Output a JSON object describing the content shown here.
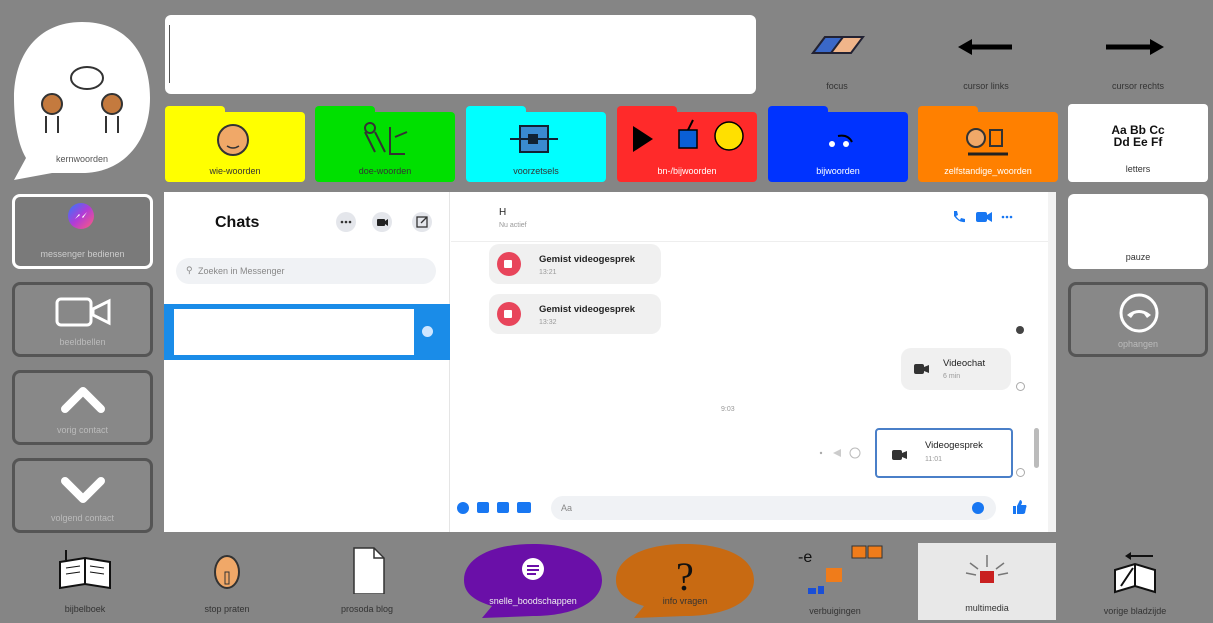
{
  "message_field": {
    "value": ""
  },
  "top_controls": [
    {
      "name": "eraser-icon",
      "label": "focus"
    },
    {
      "name": "arrow-left-icon",
      "label": "cursor links"
    },
    {
      "name": "arrow-right-icon",
      "label": "cursor rechts"
    }
  ],
  "kern": {
    "label": "kernwoorden"
  },
  "folders": [
    {
      "label": "wie-woorden",
      "color": "#ffff00"
    },
    {
      "label": "doe-woorden",
      "color": "#00e000"
    },
    {
      "label": "voorzetsels",
      "color": "#00ffff"
    },
    {
      "label": "bn-/bijwoorden",
      "color": "#ff2a2a"
    },
    {
      "label": "bijwoorden",
      "color": "#0033ff"
    },
    {
      "label": "zelfstandige_woorden",
      "color": "#ff8000"
    }
  ],
  "letters": {
    "sample": "Aa Bb Cc\nDd Ee Ff",
    "label": "letters"
  },
  "left_buttons": [
    {
      "label": "messenger bedienen"
    },
    {
      "label": "beeldbellen"
    },
    {
      "label": "vorig contact"
    },
    {
      "label": "volgend contact"
    }
  ],
  "right_buttons": [
    {
      "label": "pauze"
    },
    {
      "label": "ophangen"
    }
  ],
  "messenger": {
    "chats_title": "Chats",
    "search_placeholder": "Zoeken in Messenger",
    "contact_name": "H",
    "contact_status": "Nu actief",
    "messages": [
      {
        "title": "Gemist videogesprek",
        "time": "13:21"
      },
      {
        "title": "Gemist videogesprek",
        "time": "13:32"
      },
      {
        "title": "Videochat",
        "time": "6 min"
      },
      {
        "title": "Videogesprek",
        "time": "11:01"
      }
    ],
    "divider_time": "9:03",
    "compose_placeholder": "Aa"
  },
  "bottom_bar": [
    {
      "label": "bijbelboek"
    },
    {
      "label": "stop praten"
    },
    {
      "label": "prosoda blog"
    },
    {
      "label": "snelle_boodschappen"
    },
    {
      "label": "info vragen"
    },
    {
      "label": "verbuigingen"
    },
    {
      "label": "multimedia"
    },
    {
      "label": "vorige bladzijde"
    }
  ],
  "colors": {
    "background": "#858585",
    "messenger_blue": "#1877f2",
    "selected_row": "#1a8ce8",
    "bubble_purple": "#6a0fa8",
    "bubble_orange": "#c86a12"
  }
}
